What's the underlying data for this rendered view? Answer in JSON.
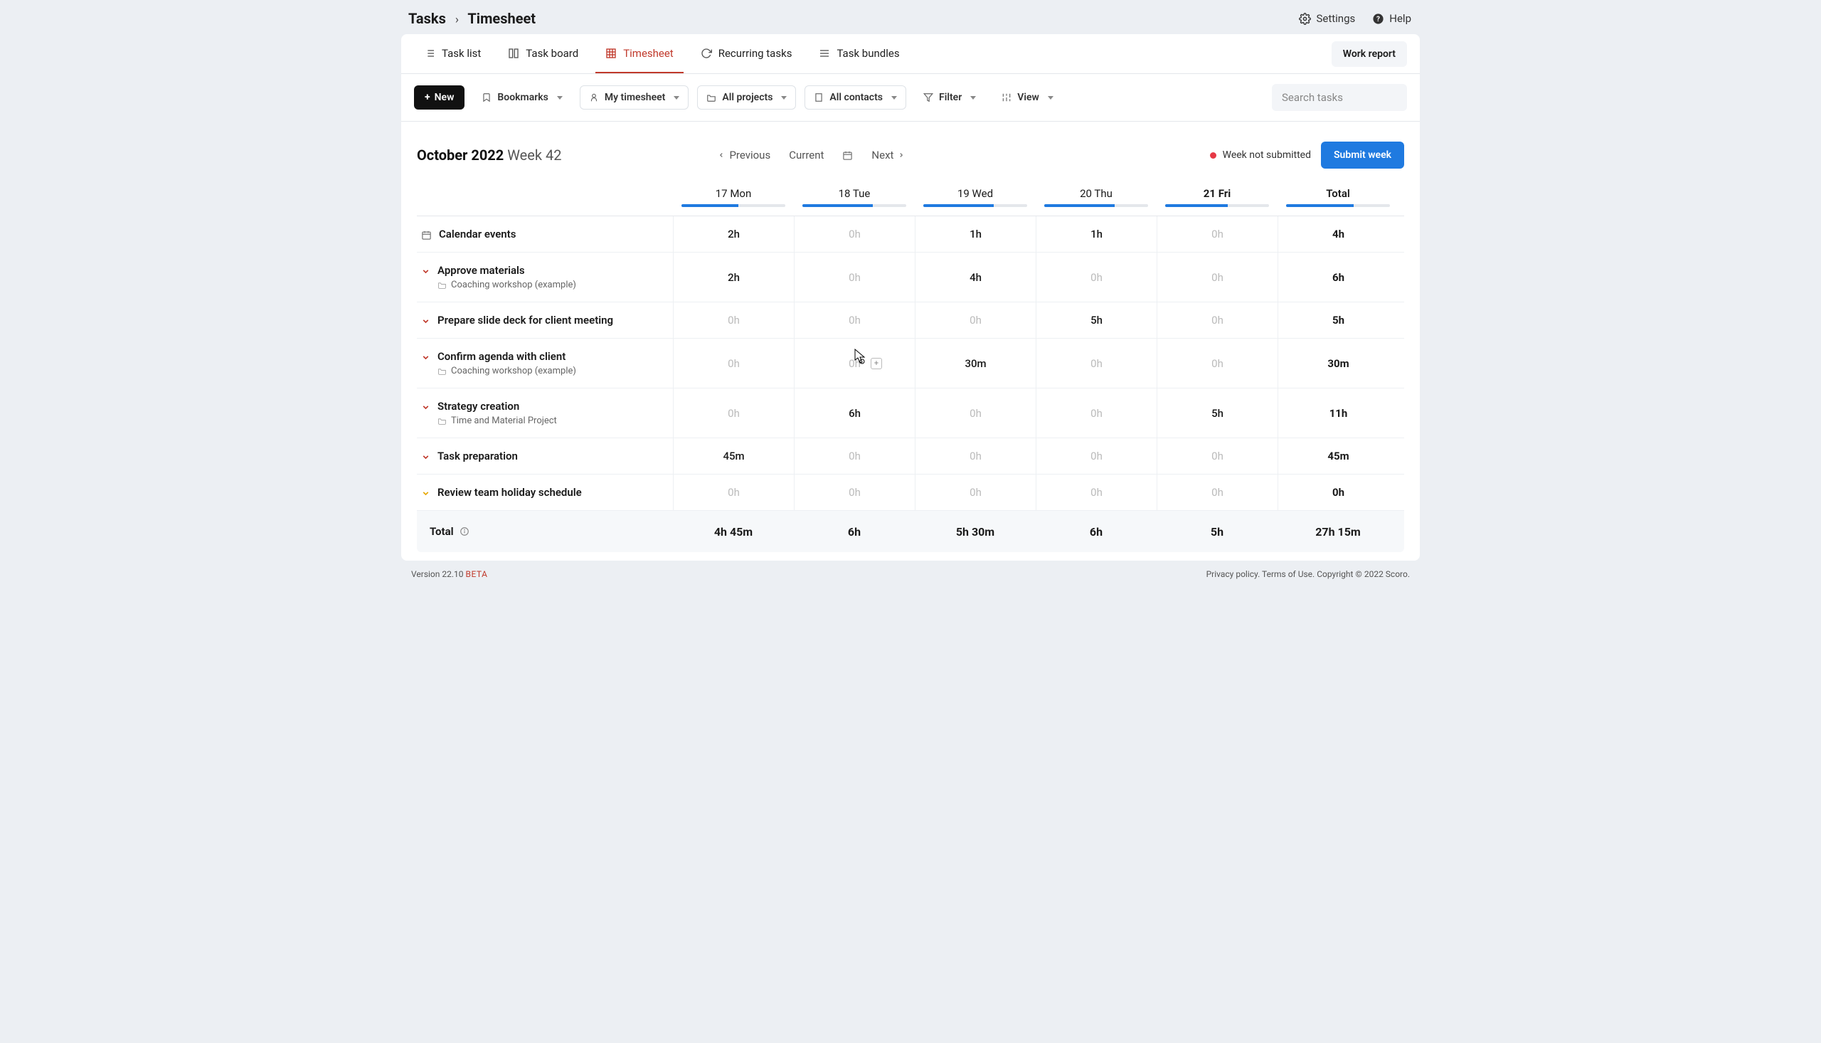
{
  "breadcrumb": {
    "root": "Tasks",
    "current": "Timesheet"
  },
  "top_links": {
    "settings": "Settings",
    "help": "Help"
  },
  "tabs": {
    "task_list": "Task list",
    "task_board": "Task board",
    "timesheet": "Timesheet",
    "recurring": "Recurring tasks",
    "bundles": "Task bundles",
    "work_report": "Work report"
  },
  "filters": {
    "new": "New",
    "bookmarks": "Bookmarks",
    "my_timesheet": "My timesheet",
    "all_projects": "All projects",
    "all_contacts": "All contacts",
    "filter": "Filter",
    "view": "View",
    "search_placeholder": "Search tasks"
  },
  "period": {
    "month": "October 2022",
    "week": "Week 42",
    "previous": "Previous",
    "current": "Current",
    "next": "Next",
    "status": "Week not submitted",
    "submit": "Submit week"
  },
  "columns": {
    "d1": "17 Mon",
    "d2": "18 Tue",
    "d3": "19 Wed",
    "d4": "20 Thu",
    "d5": "21 Fri",
    "total": "Total",
    "today_index": 5,
    "progress": {
      "d1": 55,
      "d2": 68,
      "d3": 68,
      "d4": 68,
      "d5": 60,
      "total": 65
    }
  },
  "rows": [
    {
      "kind": "calendar",
      "name": "Calendar events",
      "d1": "2h",
      "d2": "0h",
      "d3": "1h",
      "d4": "1h",
      "d5": "0h",
      "total": "4h",
      "zero": {
        "d2": true,
        "d5": true
      }
    },
    {
      "kind": "task",
      "color": "red",
      "name": "Approve materials",
      "project": "Coaching workshop (example)",
      "d1": "2h",
      "d2": "0h",
      "d3": "4h",
      "d4": "0h",
      "d5": "0h",
      "total": "6h",
      "zero": {
        "d2": true,
        "d4": true,
        "d5": true
      }
    },
    {
      "kind": "task",
      "color": "red",
      "name": "Prepare slide deck for client meeting",
      "d1": "0h",
      "d2": "0h",
      "d3": "0h",
      "d4": "5h",
      "d5": "0h",
      "total": "5h",
      "zero": {
        "d1": true,
        "d2": true,
        "d3": true,
        "d5": true
      }
    },
    {
      "kind": "task",
      "color": "red",
      "name": "Confirm agenda with client",
      "project": "Coaching workshop (example)",
      "d1": "0h",
      "d2": "0h",
      "d3": "30m",
      "d4": "0h",
      "d5": "0h",
      "total": "30m",
      "zero": {
        "d1": true,
        "d2": true,
        "d4": true,
        "d5": true
      },
      "hover_d2": true
    },
    {
      "kind": "task",
      "color": "red",
      "name": "Strategy creation",
      "project": "Time and Material Project",
      "d1": "0h",
      "d2": "6h",
      "d3": "0h",
      "d4": "0h",
      "d5": "5h",
      "total": "11h",
      "zero": {
        "d1": true,
        "d3": true,
        "d4": true
      }
    },
    {
      "kind": "task",
      "color": "red",
      "name": "Task preparation",
      "d1": "45m",
      "d2": "0h",
      "d3": "0h",
      "d4": "0h",
      "d5": "0h",
      "total": "45m",
      "zero": {
        "d2": true,
        "d3": true,
        "d4": true,
        "d5": true
      }
    },
    {
      "kind": "task",
      "color": "yellow",
      "name": "Review team holiday schedule",
      "d1": "0h",
      "d2": "0h",
      "d3": "0h",
      "d4": "0h",
      "d5": "0h",
      "total": "0h",
      "zero": {
        "d1": true,
        "d2": true,
        "d3": true,
        "d4": true,
        "d5": true
      }
    }
  ],
  "footer_row": {
    "label": "Total",
    "d1": "4h 45m",
    "d2": "6h",
    "d3": "5h 30m",
    "d4": "6h",
    "d5": "5h",
    "total": "27h 15m"
  },
  "pagefooter": {
    "version_label": "Version",
    "version": "22.10",
    "beta": "BETA",
    "privacy": "Privacy policy.",
    "terms": "Terms of Use.",
    "copyright": "Copyright © 2022 Scoro."
  }
}
